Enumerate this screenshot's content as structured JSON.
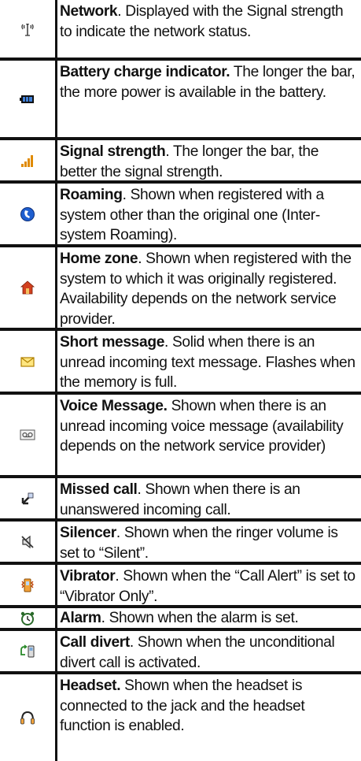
{
  "rows": [
    {
      "icon": "network-antenna-icon",
      "term": "Network",
      "sep": ". ",
      "text": "Displayed with the Signal strength to indicate the network status.",
      "height": 77
    },
    {
      "icon": "battery-icon",
      "term": "Battery charge indicator.",
      "sep": " ",
      "text": "The longer the bar, the more power is available in the battery.",
      "height": 101
    },
    {
      "icon": "signal-strength-icon",
      "term": "Signal strength",
      "sep": ". ",
      "text": "The longer the bar, the better the signal strength.",
      "height": 55
    },
    {
      "icon": "roaming-icon",
      "term": "Roaming",
      "sep": ". ",
      "text": "Shown when registered with a system other than the original one (Inter-system Roaming).",
      "height": 81
    },
    {
      "icon": "home-zone-icon",
      "term": "Home zone",
      "sep": ". ",
      "text": "Shown when registered with the system to which it was originally registered. Availability depends on the network service provider.",
      "height": 106
    },
    {
      "icon": "message-envelope-icon",
      "term": "Short message",
      "sep": ". ",
      "text": "Solid when there is an unread incoming text message. Flashes when the memory is full.",
      "height": 81
    },
    {
      "icon": "voicemail-icon",
      "term": "Voice Message.",
      "sep": " ",
      "text": "Shown when there is an unread incoming voice message (availability depends on the network service provider)",
      "height": 106
    },
    {
      "icon": "missed-call-icon",
      "term": "Missed call",
      "sep": ". ",
      "text": "Shown when there is an unanswered incoming call.",
      "height": 55
    },
    {
      "icon": "silencer-icon",
      "term": "Silencer",
      "sep": ". ",
      "text": "Shown when the ringer volume is set to “Silent”.",
      "height": 55
    },
    {
      "icon": "vibrator-icon",
      "term": "Vibrator",
      "sep": ". ",
      "text": "Shown when the “Call Alert” is set to “Vibrator Only”.",
      "height": 55
    },
    {
      "icon": "alarm-clock-icon",
      "term": "Alarm",
      "sep": ". ",
      "text": "Shown when the alarm is set.",
      "height": 29
    },
    {
      "icon": "call-divert-icon",
      "term": "Call divert",
      "sep": ". ",
      "text": "Shown when the unconditional divert call is activated.",
      "height": 55
    },
    {
      "icon": "headset-icon",
      "term": "Headset.",
      "sep": " ",
      "text": "Shown when the headset is connected to the jack and the headset function is enabled.",
      "height": 110
    }
  ]
}
